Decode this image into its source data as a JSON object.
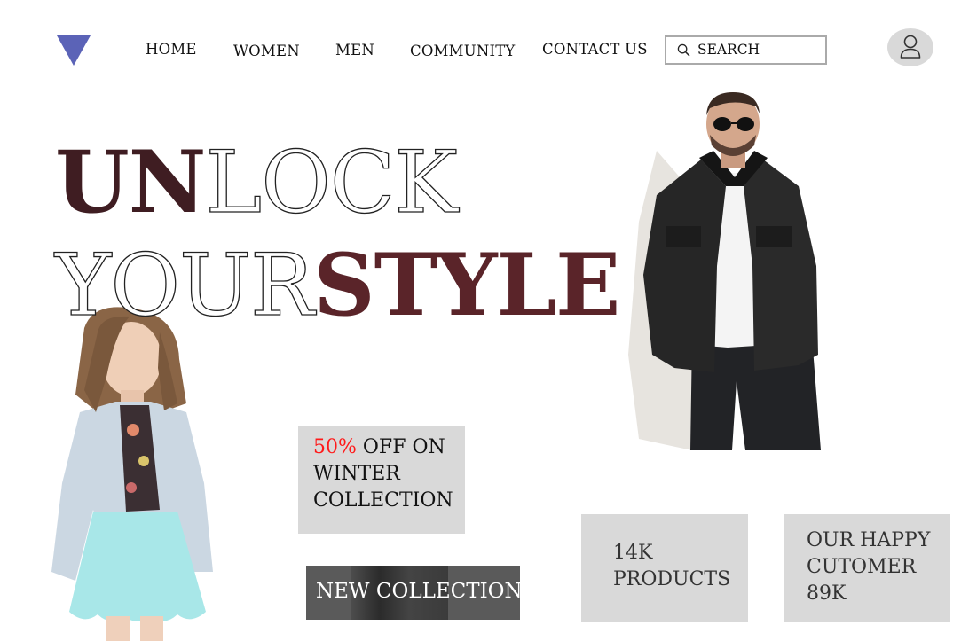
{
  "nav": {
    "items": [
      {
        "label": "HOME"
      },
      {
        "label": "WOMEN"
      },
      {
        "label": "MEN"
      },
      {
        "label": "COMMUNITY"
      },
      {
        "label": "CONTACT US"
      }
    ]
  },
  "search": {
    "placeholder": "SEARCH",
    "icon": "search-icon"
  },
  "account": {
    "icon": "user-icon"
  },
  "hero": {
    "line1_bold": "UN",
    "line1_thin": "LOCK",
    "line2_thin": "YOUR",
    "line2_bold": "STYLE"
  },
  "promo": {
    "percent": "50%",
    "line1_rest": " OFF ON",
    "line2": "WINTER",
    "line3": " COLLECTION",
    "accent_color": "#ff1a1a"
  },
  "new_collection": {
    "label": "NEW COLLECTION"
  },
  "stats": {
    "products": {
      "line1": "14K",
      "line2": "PRODUCTS"
    },
    "customers": {
      "line1": "OUR HAPPY",
      "line2": " CUTOMER",
      "line3": "89K"
    }
  },
  "colors": {
    "logo": "#5b63b7",
    "headline_dark": "#3f1d22",
    "headline_red": "#5a2429",
    "panel": "#d9d9d9"
  }
}
